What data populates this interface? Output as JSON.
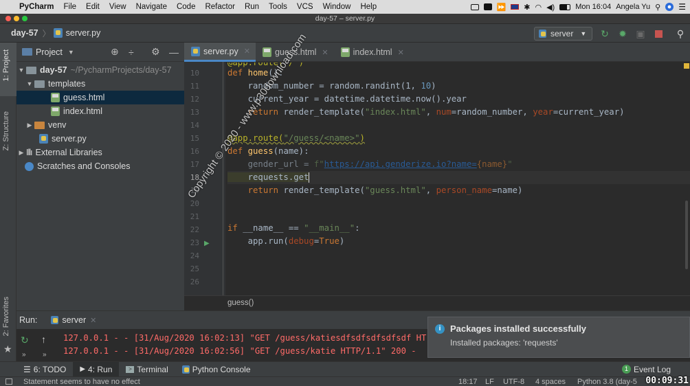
{
  "menubar": {
    "app_name": "PyCharm",
    "items": [
      "File",
      "Edit",
      "View",
      "Navigate",
      "Code",
      "Refactor",
      "Run",
      "Tools",
      "VCS",
      "Window",
      "Help"
    ],
    "clock": "Mon 16:04",
    "user": "Angela Yu"
  },
  "window": {
    "title": "day-57 – server.py"
  },
  "nav": {
    "project": "day-57",
    "file": "server.py",
    "run_config": "server"
  },
  "project_panel": {
    "title": "Project",
    "tree": [
      {
        "label": "day-57",
        "path": "~/PycharmProjects/day-57"
      },
      {
        "label": "templates"
      },
      {
        "label": "guess.html"
      },
      {
        "label": "index.html"
      },
      {
        "label": "venv"
      },
      {
        "label": "server.py"
      },
      {
        "label": "External Libraries"
      },
      {
        "label": "Scratches and Consoles"
      }
    ]
  },
  "side_tabs": {
    "project": "1: Project",
    "structure": "Z: Structure",
    "favorites": "2: Favorites"
  },
  "editor": {
    "tabs": [
      "server.py",
      "guess.html",
      "index.html"
    ],
    "line_numbers": [
      "10",
      "11",
      "12",
      "13",
      "14",
      "15",
      "16",
      "17",
      "18",
      "19",
      "20",
      "21",
      "22",
      "23",
      "24",
      "25",
      "26"
    ],
    "breadcrumb": "guess()",
    "lines": {
      "l0_dec": "@app.route(\"/\")",
      "l10_kw": "def ",
      "l10_fn": "home",
      "l10_rest": "():",
      "l11": "    random_number = random.randint(1, ",
      "l11_num": "10",
      "l11_end": ")",
      "l12": "    current_year = datetime.datetime.now().year",
      "l13_kw": "    return ",
      "l13_a": "render_template(",
      "l13_str": "\"index.html\"",
      "l13_b": ", ",
      "l13_p1": "num",
      "l13_c": "=random_number, ",
      "l13_p2": "year",
      "l13_d": "=current_year)",
      "l15_dec": "@app.route(",
      "l15_str": "\"/guess/<name>\"",
      "l15_end": ")",
      "l16_kw": "def ",
      "l16_fn": "guess",
      "l16_rest": "(name):",
      "l17_a": "    gender_url = ",
      "l17_str1": "f\"",
      "l17_url": "https://api.genderize.io?name=",
      "l17_b": "{name}",
      "l17_str2": "\"",
      "l18": "    requests.get",
      "l19_kw": "    return ",
      "l19_a": "render_template(",
      "l19_str": "\"guess.html\"",
      "l19_b": ", ",
      "l19_p": "person_name",
      "l19_c": "=name)",
      "l22_kw": "if ",
      "l22_a": "__name__ == ",
      "l22_str": "\"__main__\"",
      "l22_b": ":",
      "l23_a": "    app.run(",
      "l23_p": "debug",
      "l23_b": "=",
      "l23_kw": "True",
      "l23_c": ")"
    }
  },
  "watermark": "Copyright © 2020 - www.p30download.com",
  "run_panel": {
    "label": "Run:",
    "tab": "server",
    "log": [
      "127.0.0.1 - - [31/Aug/2020 16:02:13] \"GET /guess/katiesdfsdfsdfsdfsdf HT",
      "127.0.0.1 - - [31/Aug/2020 16:02:56] \"GET /guess/katie HTTP/1.1\" 200 -"
    ]
  },
  "notification": {
    "title": "Packages installed successfully",
    "body": "Installed packages: 'requests'"
  },
  "bottom_tabs": {
    "todo": "6: TODO",
    "run": "4: Run",
    "terminal": "Terminal",
    "console": "Python Console",
    "event_log": "Event Log",
    "event_count": "1"
  },
  "status": {
    "message": "Statement seems to have no effect",
    "position": "18:17",
    "line_sep": "LF",
    "encoding": "UTF-8",
    "indent": "4 spaces",
    "interpreter": "Python 3.8 (day-5"
  },
  "video_timer": "00:09:31",
  "colors": {
    "accent": "#4a88c7",
    "error": "#ff6b68",
    "keyword": "#cc7832",
    "string": "#6a8759"
  }
}
